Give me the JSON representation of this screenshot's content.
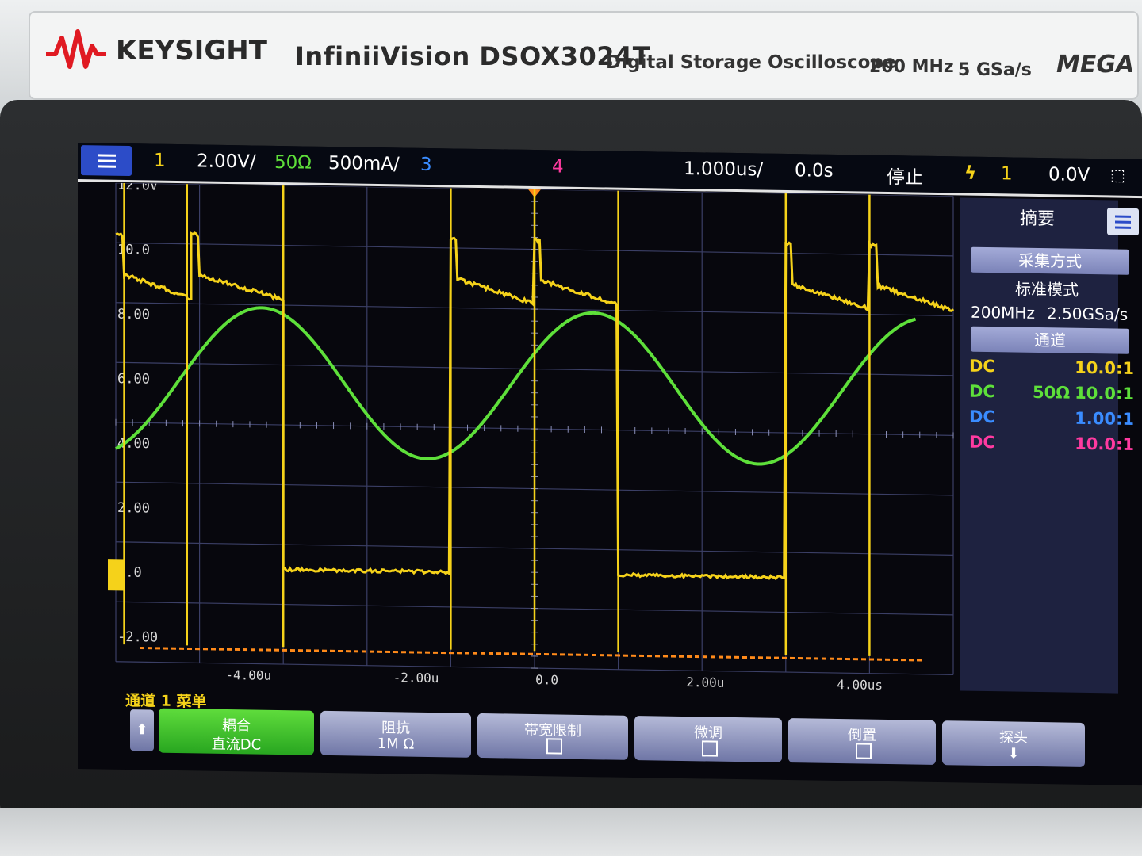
{
  "instrument": {
    "brand": "KEYSIGHT",
    "model": "InfiniiVision DSOX3024T",
    "description": "Digital Storage Oscilloscope",
    "bandwidth": "200 MHz",
    "sample_rate": "5 GSa/s",
    "badge": "MEGA"
  },
  "statusbar": {
    "ch1_num": "1",
    "ch1_scale": "2.00V/",
    "ch2_imp": "50Ω",
    "ch2_scale": "500mA/",
    "ch3_num": "3",
    "ch4_num": "4",
    "timebase": "1.000us/",
    "delay": "0.0s",
    "run_state": "停止",
    "trig_source": "1",
    "trig_level": "0.0V"
  },
  "axes": {
    "y_labels": [
      "12.0V",
      "10.0",
      "8.00",
      "6.00",
      "4.00",
      "2.00",
      "0.0",
      "-2.00"
    ],
    "x_labels": [
      "-4.00u",
      "-2.00u",
      "0.0",
      "2.00u",
      "4.00us"
    ]
  },
  "sidebar": {
    "title": "摘要",
    "acq_header": "采集方式",
    "acq_mode": "标准模式",
    "acq_bw": "200MHz",
    "acq_rate": "2.50GSa/s",
    "ch_header": "通道",
    "channels": [
      {
        "coupling": "DC",
        "imp": "",
        "probe": "10.0:1",
        "color": "#f5d21a"
      },
      {
        "coupling": "DC",
        "imp": "50Ω",
        "probe": "10.0:1",
        "color": "#5ee03a"
      },
      {
        "coupling": "DC",
        "imp": "",
        "probe": "1.00:1",
        "color": "#3a8cff"
      },
      {
        "coupling": "DC",
        "imp": "",
        "probe": "10.0:1",
        "color": "#ff3aa0"
      }
    ]
  },
  "softkeys": {
    "menu_title": "通道 1 菜单",
    "coupling_label": "耦合",
    "coupling_value": "直流DC",
    "impedance_label": "阻抗",
    "impedance_value": "1M Ω",
    "bw_limit_label": "带宽限制",
    "vernier_label": "微调",
    "invert_label": "倒置",
    "probe_label": "探头"
  },
  "colors": {
    "ch1": "#f5d21a",
    "ch2": "#5ee03a",
    "ch3": "#3a8cff",
    "ch4": "#ff3aa0",
    "grid": "#3b3f66"
  }
}
